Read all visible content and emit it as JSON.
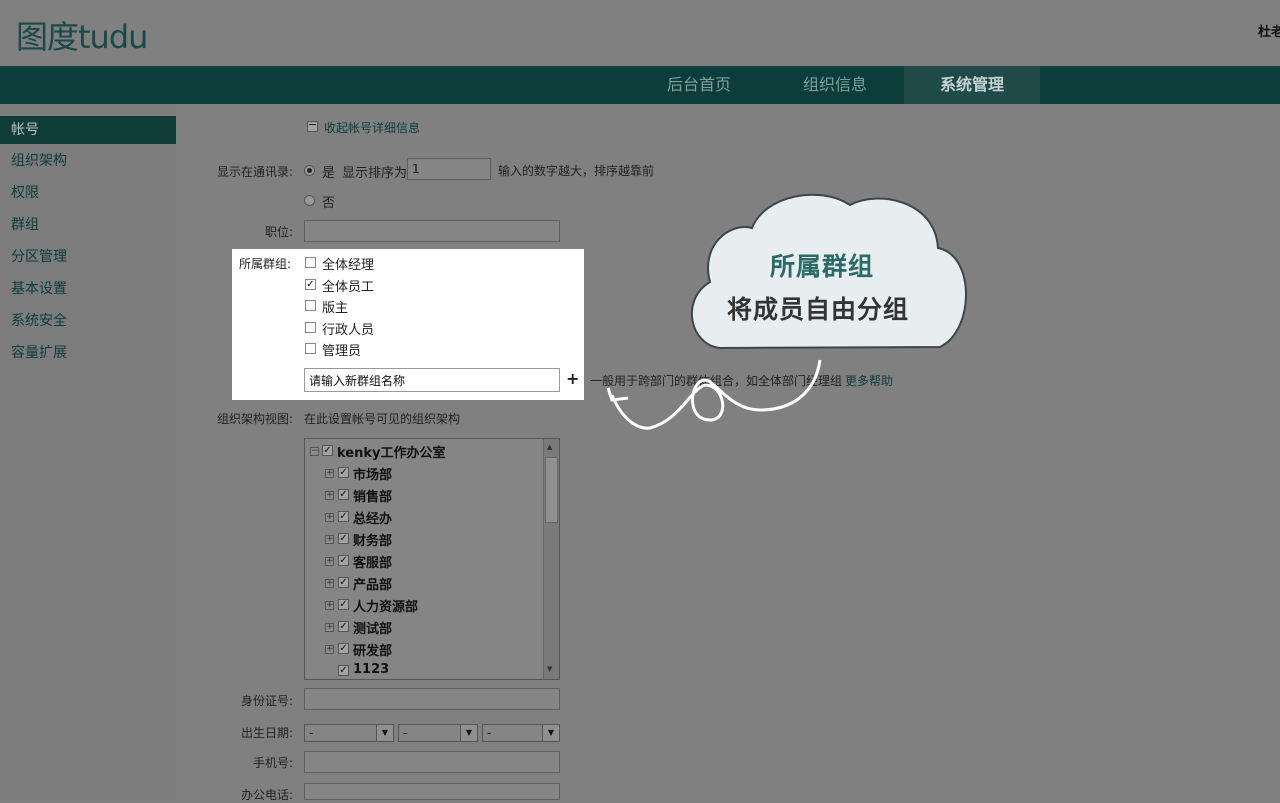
{
  "header": {
    "logo": "图度tudu",
    "user": "杜老"
  },
  "nav": {
    "tabs": [
      "后台首页",
      "组织信息",
      "系统管理"
    ]
  },
  "sidebar": {
    "items": [
      "帐号",
      "组织架构",
      "权限",
      "群组",
      "分区管理",
      "基本设置",
      "系统安全",
      "容量扩展"
    ]
  },
  "form": {
    "collapse_link": "收起帐号详细信息",
    "show_label": "显示在通讯录:",
    "yes": "是",
    "sort_label": "显示排序为",
    "sort_value": "1",
    "sort_hint": "输入的数字越大，排序越靠前",
    "no": "否",
    "position_label": "职位:",
    "groups_label": "所属群组:",
    "groups": [
      {
        "name": "全体经理",
        "checked": false
      },
      {
        "name": "全体员工",
        "checked": true
      },
      {
        "name": "版主",
        "checked": false
      },
      {
        "name": "行政人员",
        "checked": false
      },
      {
        "name": "管理员",
        "checked": false
      }
    ],
    "new_group_value": "请输入新群组名称",
    "plus": "+",
    "group_hint": "一般用于跨部门的群体组合，如全体部门经理组",
    "more_help": "更多帮助",
    "orgview_label": "组织架构视图:",
    "orgview_hint": "在此设置帐号可见的组织架构",
    "tree_root": "kenky工作办公室",
    "tree_children": [
      "市场部",
      "销售部",
      "总经办",
      "财务部",
      "客服部",
      "产品部",
      "人力资源部",
      "测试部",
      "研发部",
      "1123"
    ],
    "id_label": "身份证号:",
    "birth_label": "出生日期:",
    "birth_selects": [
      "-",
      "-",
      "-"
    ],
    "mobile_label": "手机号:",
    "office_phone_label": "办公电话:"
  },
  "callout": {
    "title": "所属群组",
    "subtitle": "将成员自由分组"
  },
  "colors": {
    "accent": "#0d3d3b",
    "callout_title": "#2a6b66"
  }
}
